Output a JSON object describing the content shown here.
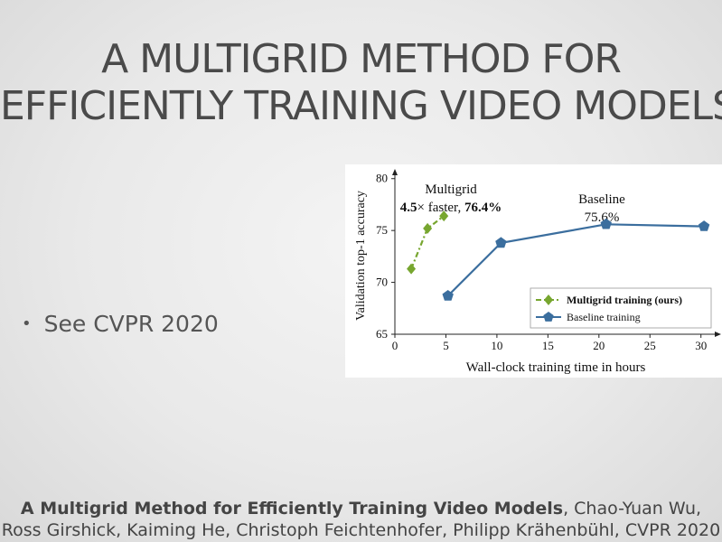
{
  "slide": {
    "title_line1": "A MULTIGRID METHOD FOR",
    "title_line2": "EFFICIENTLY TRAINING VIDEO MODELS",
    "bullet_text": "See CVPR 2020",
    "footer_bold": "A Multigrid Method for Efficiently Training Video Models",
    "footer_rest1": ", Chao-Yuan Wu,",
    "footer_line2": "Ross Girshick, Kaiming He, Christoph Feichtenhofer, Philipp Krähenbühl, CVPR 2020"
  },
  "chart_data": {
    "type": "line",
    "xlabel": "Wall-clock training time in hours",
    "ylabel": "Validation top-1 accuracy",
    "xlim": [
      0,
      31
    ],
    "ylim": [
      65,
      80.5
    ],
    "xticks": [
      0,
      5,
      10,
      15,
      20,
      25,
      30
    ],
    "yticks": [
      65,
      70,
      75,
      80
    ],
    "grid": false,
    "legend_position": "bottom-right",
    "series": [
      {
        "name": "Multigrid training (ours)",
        "color": "#77a62f",
        "marker": "diamond",
        "line_style": "dash-dot",
        "x": [
          1.6,
          3.2,
          4.8
        ],
        "y": [
          71.3,
          75.2,
          76.4
        ]
      },
      {
        "name": "Baseline training",
        "color": "#3b6e9e",
        "marker": "pentagon",
        "line_style": "solid",
        "x": [
          5.2,
          10.4,
          20.7,
          30.3
        ],
        "y": [
          68.7,
          73.8,
          75.6,
          75.4
        ]
      }
    ],
    "annotations": [
      {
        "text_line1": "Multigrid",
        "text_line2_bold_a": "4.5",
        "text_line2_mid": "× faster, ",
        "text_line2_bold_b": "76.4%"
      },
      {
        "text_line1": "Baseline",
        "text_line2": "75.6%"
      }
    ]
  }
}
